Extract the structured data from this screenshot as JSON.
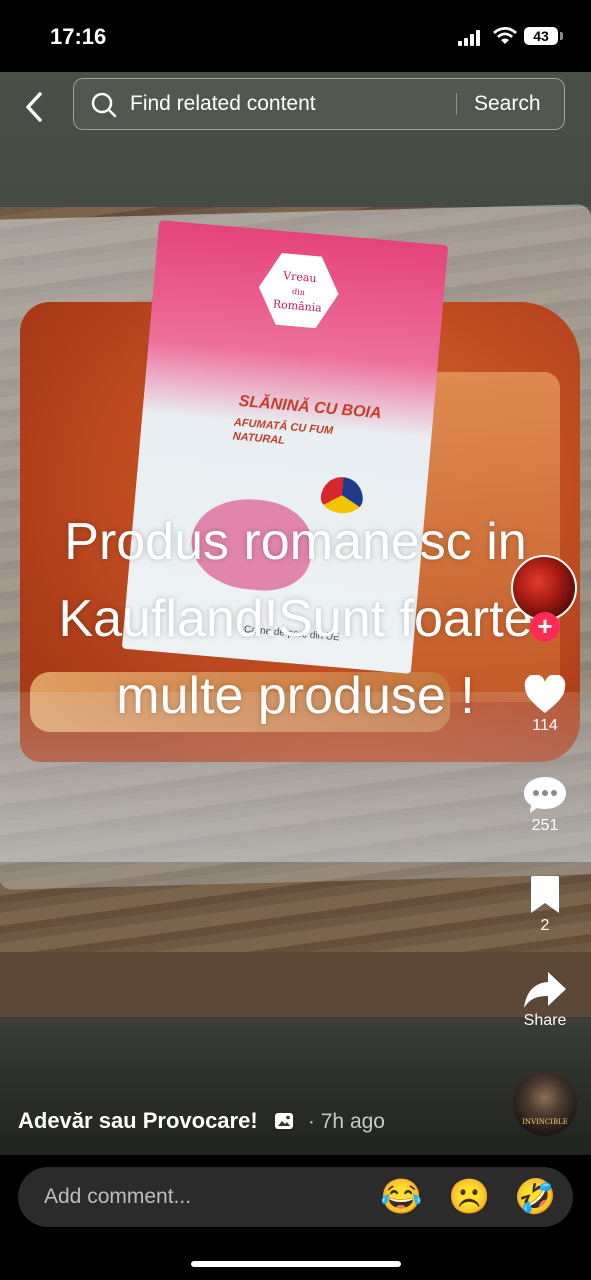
{
  "status_bar": {
    "time": "17:16",
    "battery": "43"
  },
  "search": {
    "placeholder": "Find related content",
    "button_label": "Search"
  },
  "video": {
    "overlay_text": "Produs romanesc in Kaufland!Sunt foarte multe produse !",
    "product_label": {
      "brand_top": "Vreau",
      "brand_mid": "din",
      "brand_bottom": "România",
      "title": "SLĂNINĂ CU BOIA",
      "subtitle": "AFUMATĂ CU FUM NATURAL",
      "footer": "Carne de porc din UE"
    }
  },
  "actions": {
    "likes": "114",
    "comments": "251",
    "saves": "2",
    "share_label": "Share"
  },
  "post": {
    "author": "Adevăr sau Provocare!",
    "time_ago": "· 7h ago",
    "music_label": "INVINCIBLE"
  },
  "comment": {
    "placeholder": "Add comment...",
    "emojis": [
      "😂",
      "☹️",
      "🤣"
    ]
  }
}
